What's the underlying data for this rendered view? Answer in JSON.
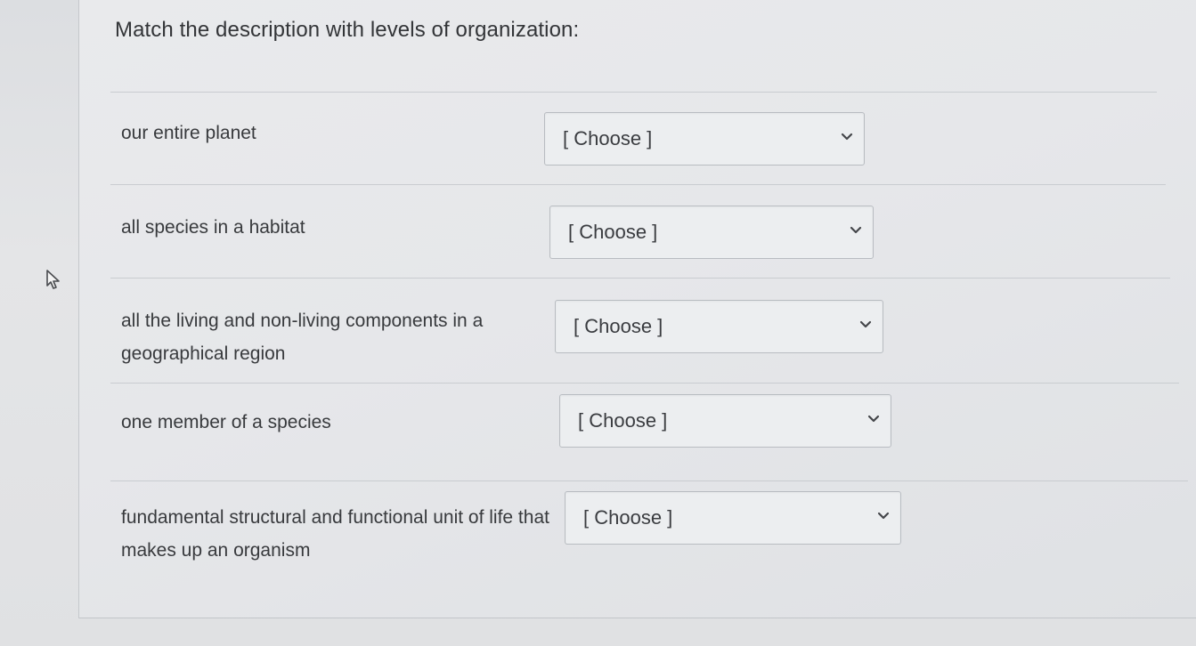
{
  "question": {
    "title": "Match the description with levels of organization:"
  },
  "items": [
    {
      "prompt": "our entire planet",
      "selected": "[ Choose ]"
    },
    {
      "prompt": "all species in a habitat",
      "selected": "[ Choose ]"
    },
    {
      "prompt": "all the living and non-living components in a geographical region",
      "selected": "[ Choose ]"
    },
    {
      "prompt": "one member of a species",
      "selected": "[ Choose ]"
    },
    {
      "prompt": "fundamental structural and functional unit of life that makes up an organism",
      "selected": "[ Choose ]"
    }
  ],
  "icons": {
    "cursor": "mouse-pointer-icon",
    "dropdown": "chevron-down-icon"
  },
  "colors": {
    "background": "#d6d8dc",
    "card": "#e8e9eb",
    "text": "#383a3d",
    "border": "#b8bcc1"
  }
}
